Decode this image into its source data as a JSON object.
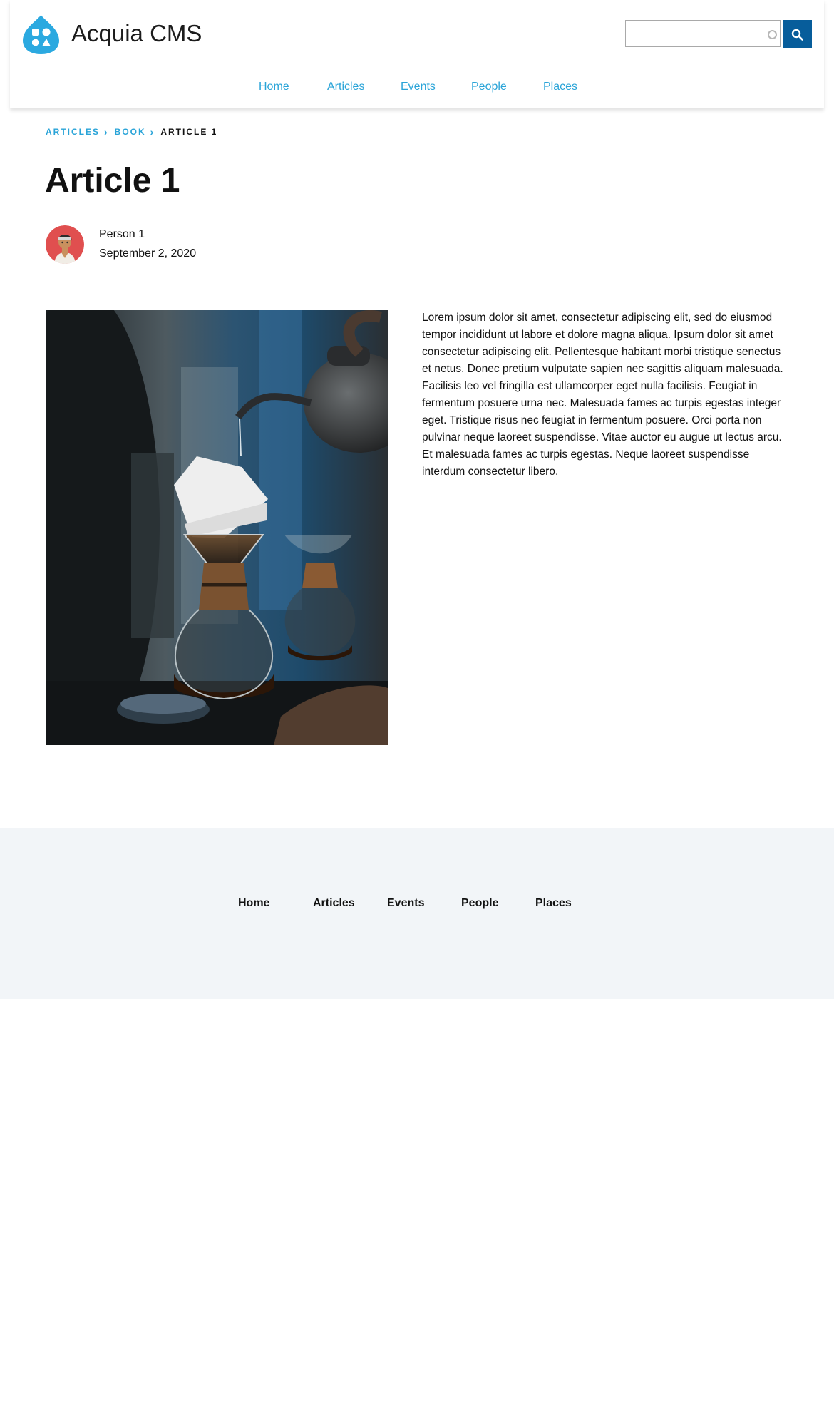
{
  "header": {
    "site_name": "Acquia CMS",
    "search": {
      "value": "",
      "placeholder": ""
    },
    "nav": [
      "Home",
      "Articles",
      "Events",
      "People",
      "Places"
    ]
  },
  "breadcrumb": {
    "items": [
      "ARTICLES",
      "BOOK"
    ],
    "current": "ARTICLE 1"
  },
  "article": {
    "title": "Article 1",
    "author": "Person 1",
    "date": "September 2, 2020",
    "body": "Lorem ipsum dolor sit amet, consectetur adipiscing elit, sed do eiusmod tempor incididunt ut labore et dolore magna aliqua. Ipsum dolor sit amet consectetur adipiscing elit. Pellentesque habitant morbi tristique senectus et netus. Donec pretium vulputate sapien nec sagittis aliquam malesuada. Facilisis leo vel fringilla est ullamcorper eget nulla facilisis. Feugiat in fermentum posuere urna nec. Malesuada fames ac turpis egestas integer eget. Tristique risus nec feugiat in fermentum posuere. Orci porta non pulvinar neque laoreet suspendisse. Vitae auctor eu augue ut lectus arcu. Et malesuada fames ac turpis egestas. Neque laoreet suspendisse interdum consectetur libero."
  },
  "footer": {
    "nav": [
      "Home",
      "Articles",
      "Events",
      "People",
      "Places"
    ]
  },
  "icons": {
    "logo": "drupal-drop-icon",
    "search": "magnifier-icon",
    "breadcrumb_separator": "chevron-right-icon",
    "avatar": "person-avatar-icon"
  },
  "colors": {
    "link": "#2aa4d8",
    "search_button": "#075d9b",
    "footer_bg": "#f2f5f8",
    "logo": "#2ba9e0"
  }
}
